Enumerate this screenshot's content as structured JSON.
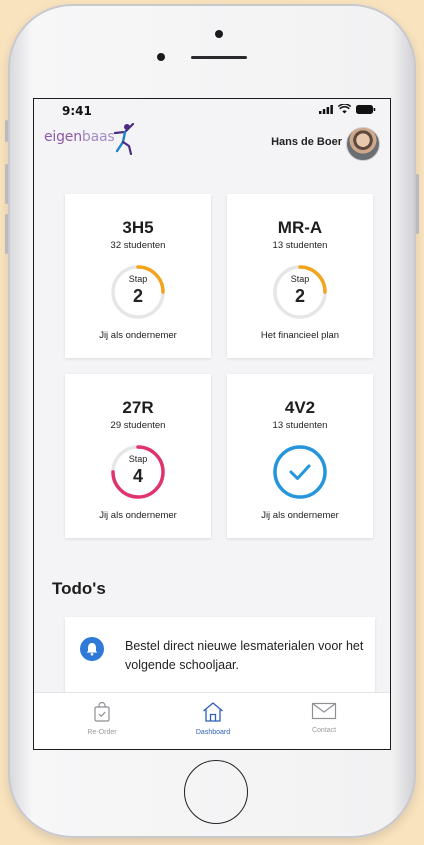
{
  "status_bar": {
    "time": "9:41"
  },
  "header": {
    "logo_part1": "eigen",
    "logo_part2": "baas",
    "user_name": "Hans de Boer"
  },
  "cards": [
    {
      "code": "3H5",
      "students": "32 studenten",
      "step_label": "Stap",
      "step": "2",
      "description": "Jij als ondernemer",
      "progress": 0.25,
      "color": "#f2a51c"
    },
    {
      "code": "MR-A",
      "students": "13 studenten",
      "step_label": "Stap",
      "step": "2",
      "description": "Het financieel plan",
      "progress": 0.25,
      "color": "#f2a51c"
    },
    {
      "code": "27R",
      "students": "29 studenten",
      "step_label": "Stap",
      "step": "4",
      "description": "Jij als ondernemer",
      "progress": 0.75,
      "color": "#e0336f"
    },
    {
      "code": "4V2",
      "students": "13 studenten",
      "description": "Jij als ondernemer",
      "progress": 1.0,
      "color": "#2596dc",
      "completed": true
    }
  ],
  "todos": {
    "title": "Todo's",
    "items": [
      {
        "text": "Bestel direct nieuwe lesmaterialen voor het volgende schooljaar.",
        "icon": "bell-icon"
      }
    ]
  },
  "tabbar": {
    "items": [
      {
        "label": "Re-Order",
        "icon": "shopping-bag-icon",
        "active": false
      },
      {
        "label": "Dashboard",
        "icon": "home-icon",
        "active": true
      },
      {
        "label": "Contact",
        "icon": "mail-icon",
        "active": false
      }
    ]
  },
  "colors": {
    "accent": "#2f5fb8",
    "background": "#f9e3be"
  }
}
